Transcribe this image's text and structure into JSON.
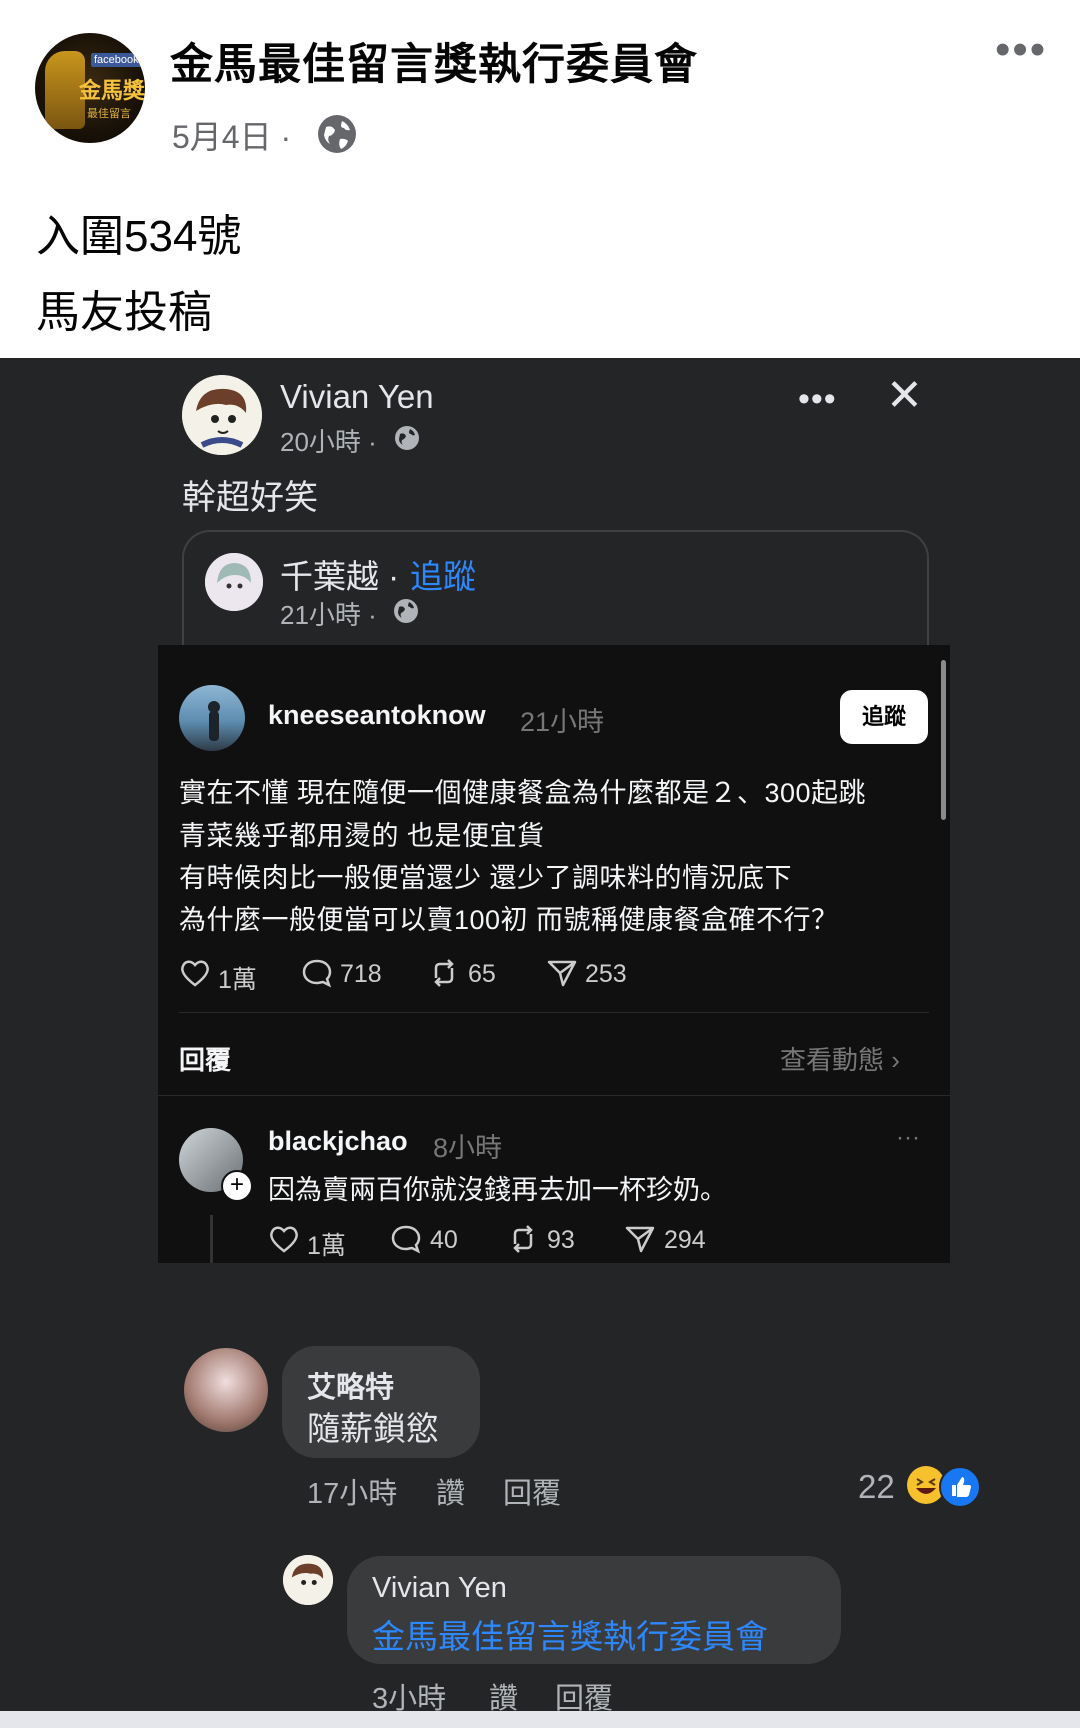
{
  "post": {
    "page_name": "金馬最佳留言獎執行委員會",
    "date": "5月4日 ·",
    "line1": "入圍534號",
    "line2": "馬友投稿",
    "avatar_texts": {
      "fb": "facebook",
      "gm": "金馬獎",
      "gm2": "最佳留言"
    },
    "more_icon": "more-horizontal-icon"
  },
  "shared": {
    "author": "Vivian Yen",
    "time": "20小時 ·",
    "text": "幹超好笑",
    "card": {
      "author": "千葉越",
      "separator": " · ",
      "follow": "追蹤",
      "time": "21小時 ·"
    }
  },
  "threads": {
    "post": {
      "user": "kneeseantoknow",
      "time": "21小時",
      "follow_button": "追蹤",
      "lines": [
        "實在不懂 現在隨便一個健康餐盒為什麼都是２、300起跳",
        "青菜幾乎都用燙的 也是便宜貨",
        "有時候肉比一般便當還少 還少了調味料的情況底下",
        "為什麼一般便當可以賣100初 而號稱健康餐盒確不行？"
      ],
      "stats": {
        "likes": "1萬",
        "comments": "718",
        "reposts": "65",
        "shares": "253"
      }
    },
    "reply_label": "回覆",
    "view_activity": "查看動態 ›",
    "reply": {
      "user": "blackjchao",
      "time": "8小時",
      "text": "因為賣兩百你就沒錢再去加一杯珍奶。",
      "more": "···",
      "stats": {
        "likes": "1萬",
        "comments": "40",
        "reposts": "93",
        "shares": "294"
      }
    }
  },
  "comments": [
    {
      "author": "艾略特",
      "text": "隨薪鎖慾",
      "time": "17小時",
      "like": "讚",
      "reply": "回覆",
      "reaction_count": "22",
      "reactions": [
        "haha-icon",
        "like-icon"
      ]
    },
    {
      "author": "Vivian Yen",
      "text": "金馬最佳留言獎執行委員會",
      "time": "3小時",
      "like": "讚",
      "reply": "回覆"
    }
  ],
  "colors": {
    "dark_bg": "#242526",
    "threads_bg": "#101010",
    "bubble": "#3a3b3c",
    "link_blue": "#2d88ff",
    "fb_blue": "#1877f2"
  }
}
